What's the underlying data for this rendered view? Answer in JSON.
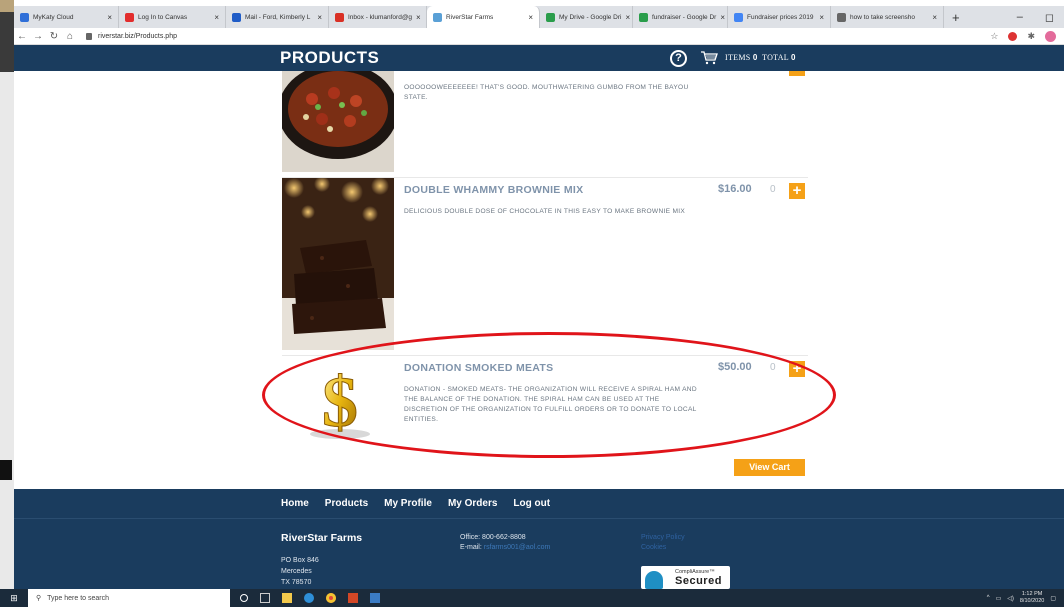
{
  "browser": {
    "tabs": [
      {
        "label": "MyKaty Cloud",
        "color": "#2f6fd8"
      },
      {
        "label": "Log In to Canvas",
        "color": "#e22d2d"
      },
      {
        "label": "Mail - Ford, Kimberly L",
        "color": "#1f5cc7"
      },
      {
        "label": "Inbox - klumanford@g",
        "color": "#d93025"
      },
      {
        "label": "RiverStar Farms",
        "color": "#5aa0d6"
      },
      {
        "label": "My Drive - Google Dri",
        "color": "#2a9d4b"
      },
      {
        "label": "fundraiser - Google Dr",
        "color": "#2a9d4b"
      },
      {
        "label": "Fundraiser prices 2019",
        "color": "#4285f4"
      },
      {
        "label": "how to take screensho",
        "color": "#666666"
      }
    ],
    "active_tab_index": 4,
    "url": "riverstar.biz/Products.php",
    "new_tab_symbol": "+",
    "close_symbol": "×",
    "min_symbol": "–",
    "max_symbol": "◻"
  },
  "site": {
    "page_title": "PRODUCTS",
    "help_symbol": "?",
    "items_label": "ITEMS",
    "items_count": "0",
    "total_label": "TOTAL",
    "total_value": "0",
    "top_desc": "OOOOOOWEEEEEEE! THAT'S GOOD. MOUTHWATERING GUMBO FROM THE BAYOU STATE.",
    "products": [
      {
        "name": "DOUBLE WHAMMY BROWNIE MIX",
        "price": "$16.00",
        "qty": "0",
        "description": "DELICIOUS DOUBLE DOSE OF CHOCOLATE IN THIS EASY TO MAKE BROWNIE MIX"
      },
      {
        "name": "DONATION SMOKED MEATS",
        "price": "$50.00",
        "qty": "0",
        "description": "DONATION - SMOKED MEATS- THE ORGANIZATION WILL RECEIVE A SPIRAL HAM AND THE BALANCE OF THE DONATION. THE SPIRAL HAM CAN BE USED AT THE DISCRETION OF THE ORGANIZATION TO FULFILL ORDERS OR TO DONATE TO LOCAL ENTITIES."
      }
    ],
    "add_symbol": "+",
    "view_cart_label": "View Cart"
  },
  "footer": {
    "nav": [
      "Home",
      "Products",
      "My Profile",
      "My Orders",
      "Log out"
    ],
    "brand": "RiverStar Farms",
    "address_lines": [
      "PO Box 846",
      "Mercedes",
      "TX 78570"
    ],
    "office": "Office: 800-662-8808",
    "email_label": "E-mail:",
    "email": "rsfarms001@aol.com",
    "links": [
      "Privacy Policy",
      "Cookies"
    ],
    "badge_top": "CompliAssure™",
    "badge_main": "Secured"
  },
  "taskbar": {
    "search_placeholder": "Type here to search",
    "time": "1:12 PM",
    "date": "8/10/2020"
  },
  "colors": {
    "header_navy": "#1a3c5e",
    "accent_orange": "#f5a117",
    "highlight_red": "#e0141a"
  }
}
